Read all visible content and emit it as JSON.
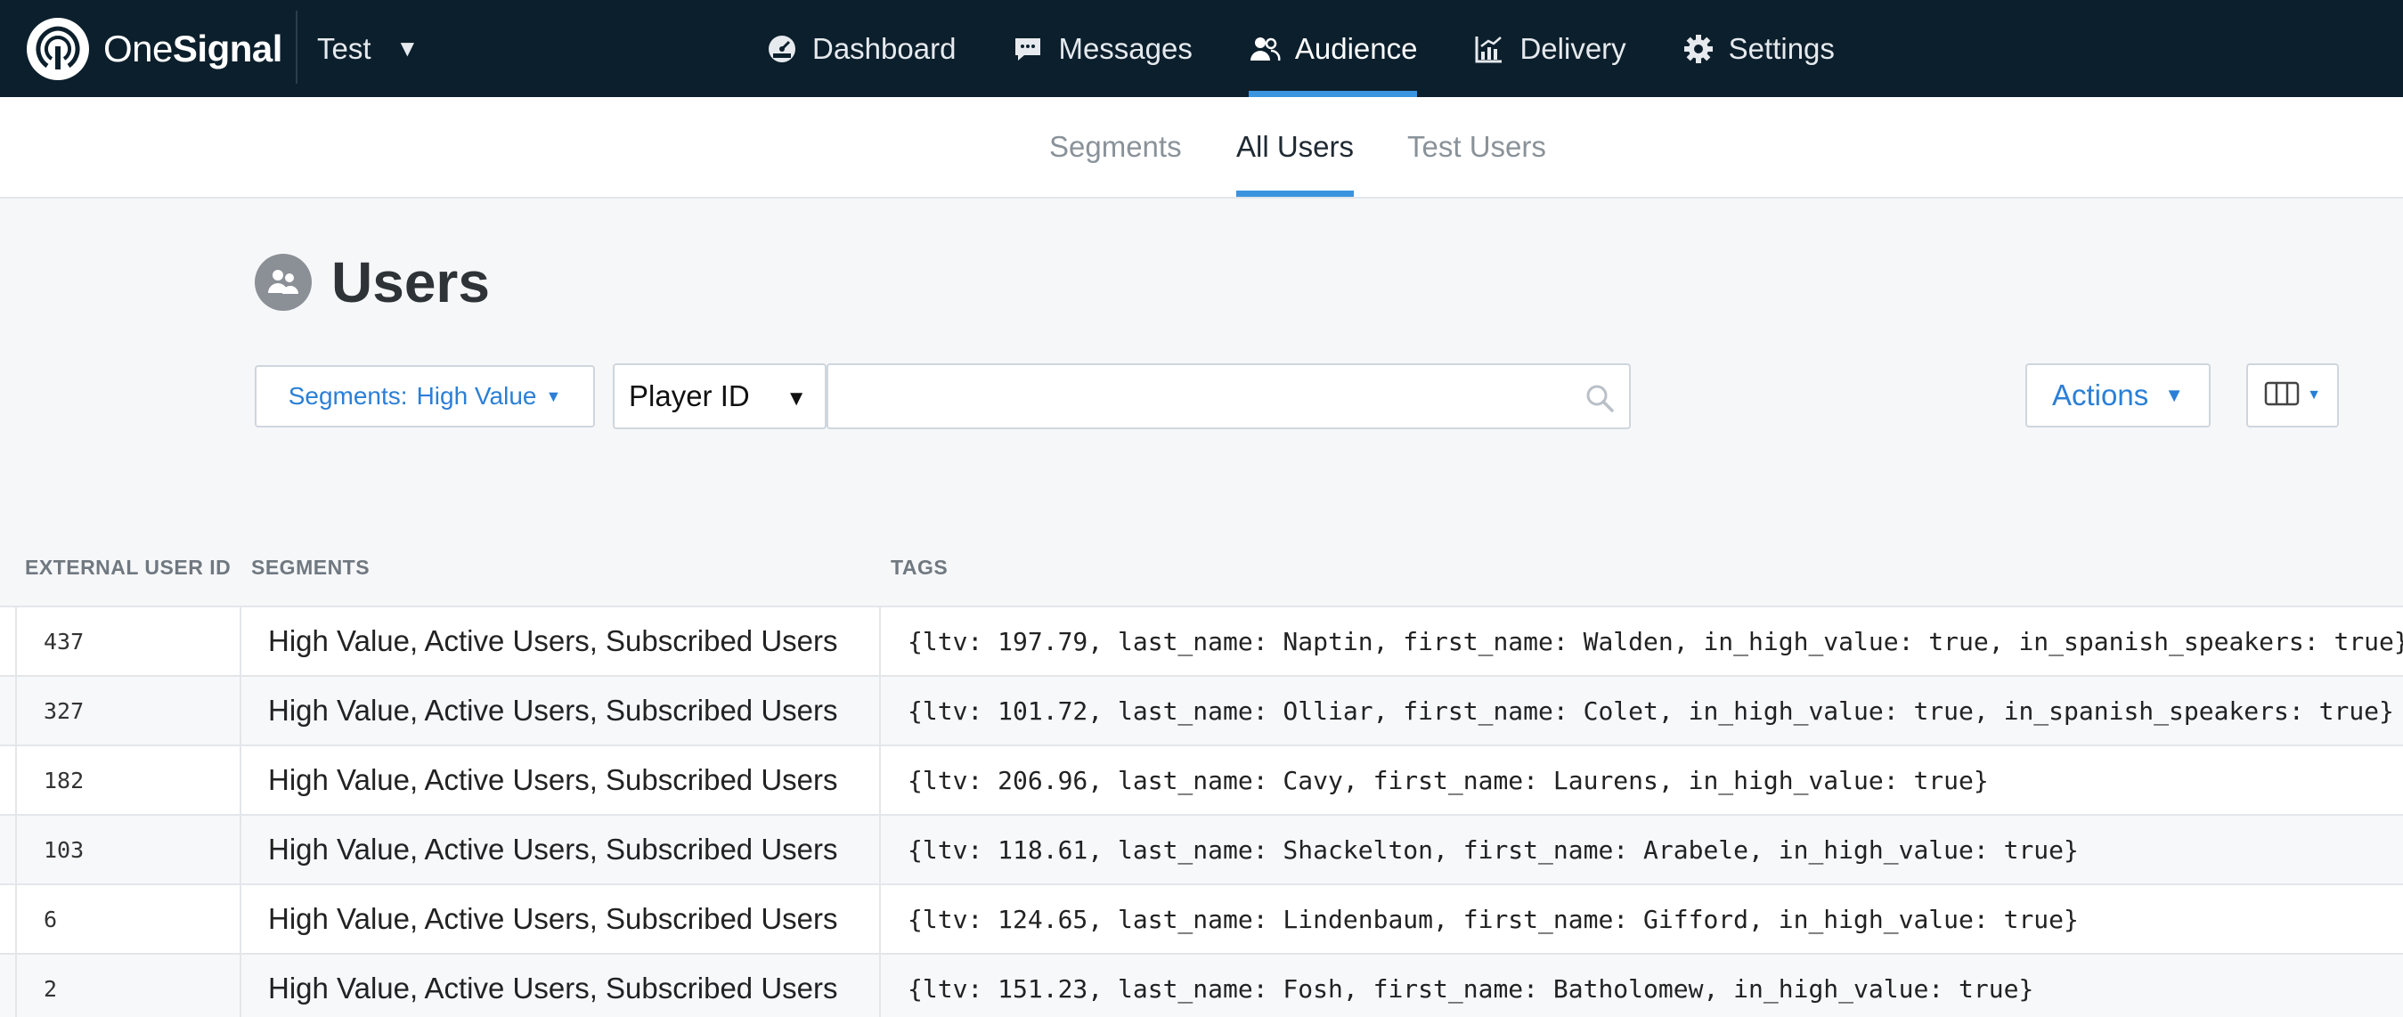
{
  "brand": {
    "name_light": "One",
    "name_bold": "Signal"
  },
  "app_switcher": {
    "label": "Test"
  },
  "main_nav": [
    {
      "label": "Dashboard",
      "icon": "dashboard-gauge-icon"
    },
    {
      "label": "Messages",
      "icon": "messages-icon"
    },
    {
      "label": "Audience",
      "icon": "audience-icon",
      "active": true
    },
    {
      "label": "Delivery",
      "icon": "delivery-chart-icon"
    },
    {
      "label": "Settings",
      "icon": "gear-icon"
    }
  ],
  "sub_nav": [
    {
      "label": "Segments"
    },
    {
      "label": "All Users",
      "active": true
    },
    {
      "label": "Test Users"
    }
  ],
  "page": {
    "title": "Users",
    "icon": "users-icon"
  },
  "filters": {
    "segment_prefix": "Segments:",
    "segment_value": "High Value",
    "field_select": "Player ID",
    "search_placeholder": "",
    "actions_label": "Actions"
  },
  "table": {
    "headers": {
      "external_id": "EXTERNAL USER ID",
      "segments": "SEGMENTS",
      "tags": "TAGS"
    },
    "rows": [
      {
        "id": "437",
        "segments": "High Value, Active Users, Subscribed Users",
        "tags": "{ltv: 197.79, last_name: Naptin, first_name: Walden, in_high_value: true, in_spanish_speakers: true}"
      },
      {
        "id": "327",
        "segments": "High Value, Active Users, Subscribed Users",
        "tags": "{ltv: 101.72, last_name: Olliar, first_name: Colet, in_high_value: true, in_spanish_speakers: true}"
      },
      {
        "id": "182",
        "segments": "High Value, Active Users, Subscribed Users",
        "tags": "{ltv: 206.96, last_name: Cavy, first_name: Laurens, in_high_value: true}"
      },
      {
        "id": "103",
        "segments": "High Value, Active Users, Subscribed Users",
        "tags": "{ltv: 118.61, last_name: Shackelton, first_name: Arabele, in_high_value: true}"
      },
      {
        "id": "6",
        "segments": "High Value, Active Users, Subscribed Users",
        "tags": "{ltv: 124.65, last_name: Lindenbaum, first_name: Gifford, in_high_value: true}"
      },
      {
        "id": "2",
        "segments": "High Value, Active Users, Subscribed Users",
        "tags": "{ltv: 151.23, last_name: Fosh, first_name: Batholomew, in_high_value: true}"
      }
    ]
  },
  "colors": {
    "topbar": "#0c1f2c",
    "accent": "#3a94e0",
    "link": "#2b7fd6",
    "background": "#f6f7f9"
  }
}
